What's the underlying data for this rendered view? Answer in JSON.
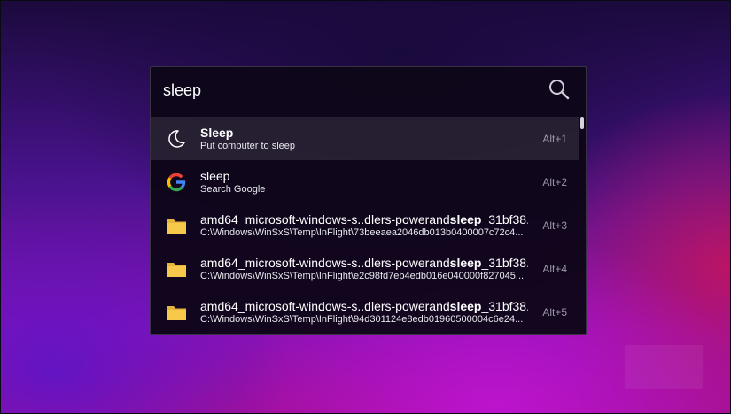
{
  "search": {
    "query": "sleep",
    "icon": "search-icon"
  },
  "results": [
    {
      "title_pre": "",
      "title_bold": "Sleep",
      "title_post": "",
      "subtitle": "Put computer to sleep",
      "shortcut": "Alt+1",
      "icon": "moon-icon",
      "selected": true
    },
    {
      "title_pre": "sleep",
      "title_bold": "",
      "title_post": "",
      "subtitle": "Search Google",
      "shortcut": "Alt+2",
      "icon": "google-icon"
    },
    {
      "title_pre": "amd64_microsoft-windows-s..dlers-powerand",
      "title_bold": "sleep",
      "title_post": "_31bf38...",
      "subtitle": "C:\\Windows\\WinSxS\\Temp\\InFlight\\73beeaea2046db013b0400007c72c4...",
      "shortcut": "Alt+3",
      "icon": "folder-icon"
    },
    {
      "title_pre": "amd64_microsoft-windows-s..dlers-powerand",
      "title_bold": "sleep",
      "title_post": "_31bf38...",
      "subtitle": "C:\\Windows\\WinSxS\\Temp\\InFlight\\e2c98fd7eb4edb016e040000f827045...",
      "shortcut": "Alt+4",
      "icon": "folder-icon"
    },
    {
      "title_pre": "amd64_microsoft-windows-s..dlers-powerand",
      "title_bold": "sleep",
      "title_post": "_31bf38...",
      "subtitle": "C:\\Windows\\WinSxS\\Temp\\InFlight\\94d301124e8edb01960500004c6e24...",
      "shortcut": "Alt+5",
      "icon": "folder-icon"
    }
  ],
  "colors": {
    "folder": "#f6c94a",
    "google_blue": "#4285f4",
    "google_red": "#ea4335",
    "google_yellow": "#fbbc05",
    "google_green": "#34a853"
  }
}
